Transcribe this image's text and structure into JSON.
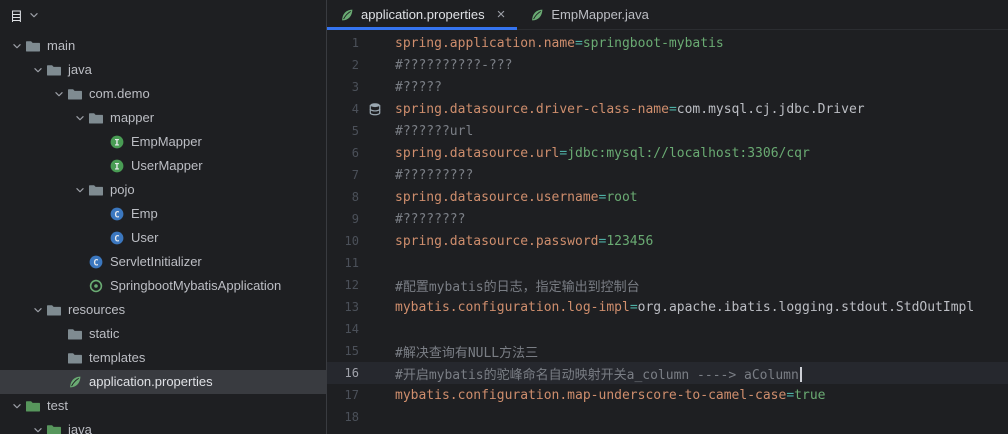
{
  "colors": {
    "app-bg": "#1e1f22",
    "panel-bg": "#1e1f22",
    "editor-bg": "#1e1f22",
    "border": "#393b40",
    "fg": "#bcbec4",
    "fg-bright": "#dfe1e5",
    "key": "#cf8e6d",
    "eq": "#4eb0a5",
    "value": "#6aab73",
    "classref": "#bcbec4",
    "comment": "#7a7e85",
    "line-num": "#4b5059",
    "line-num-current": "#a1a3ab",
    "current-line": "#26282e",
    "selection": "#393b40",
    "tab-underline": "#3574f0",
    "caret": "#ced0d6",
    "chevron": "#9da0a8",
    "leaf-green": "#6aab73",
    "interface-green": "#499c54",
    "class-blue": "#3b77bf",
    "folder-gray": "#7f8b91",
    "folder-green": "#57965c",
    "db-icon": "#9aa7b0"
  },
  "project_panel": {
    "header": {
      "title": "目"
    },
    "tree": [
      {
        "label": "main",
        "icon": "folder-icon",
        "depth": 0,
        "chevron": true,
        "selected": false
      },
      {
        "label": "java",
        "icon": "folder-icon",
        "depth": 1,
        "chevron": true,
        "selected": false
      },
      {
        "label": "com.demo",
        "icon": "package-icon",
        "depth": 2,
        "chevron": true,
        "selected": false
      },
      {
        "label": "mapper",
        "icon": "package-icon",
        "depth": 3,
        "chevron": true,
        "selected": false
      },
      {
        "label": "EmpMapper",
        "icon": "interface-icon",
        "depth": 4,
        "chevron": false,
        "selected": false
      },
      {
        "label": "UserMapper",
        "icon": "interface-icon",
        "depth": 4,
        "chevron": false,
        "selected": false
      },
      {
        "label": "pojo",
        "icon": "package-icon",
        "depth": 3,
        "chevron": true,
        "selected": false
      },
      {
        "label": "Emp",
        "icon": "class-icon",
        "depth": 4,
        "chevron": false,
        "selected": false
      },
      {
        "label": "User",
        "icon": "class-icon",
        "depth": 4,
        "chevron": false,
        "selected": false
      },
      {
        "label": "ServletInitializer",
        "icon": "class-icon",
        "depth": 3,
        "chevron": false,
        "selected": false
      },
      {
        "label": "SpringbootMybatisApplication",
        "icon": "spring-boot-icon",
        "depth": 3,
        "chevron": false,
        "selected": false
      },
      {
        "label": "resources",
        "icon": "folder-icon",
        "depth": 1,
        "chevron": true,
        "selected": false
      },
      {
        "label": "static",
        "icon": "folder-icon",
        "depth": 2,
        "chevron": false,
        "selected": false
      },
      {
        "label": "templates",
        "icon": "folder-icon",
        "depth": 2,
        "chevron": false,
        "selected": false
      },
      {
        "label": "application.properties",
        "icon": "spring-leaf-icon",
        "depth": 2,
        "chevron": false,
        "selected": true
      },
      {
        "label": "test",
        "icon": "test-folder-icon",
        "depth": 0,
        "chevron": true,
        "selected": false
      },
      {
        "label": "java",
        "icon": "test-folder-icon",
        "depth": 1,
        "chevron": true,
        "selected": false
      }
    ]
  },
  "editor": {
    "tabs": [
      {
        "label": "application.properties",
        "icon": "spring-leaf-icon",
        "active": true,
        "closable": true,
        "close_glyph": "×"
      },
      {
        "label": "EmpMapper.java",
        "icon": "spring-leaf-icon",
        "active": false,
        "closable": false
      }
    ],
    "lines": [
      {
        "num": 1,
        "segments": [
          {
            "type": "key",
            "text": "spring.application.name"
          },
          {
            "type": "eq",
            "text": "="
          },
          {
            "type": "value",
            "text": "springboot-mybatis"
          }
        ]
      },
      {
        "num": 2,
        "segments": [
          {
            "type": "comment",
            "text": "#??????????-???"
          }
        ]
      },
      {
        "num": 3,
        "segments": [
          {
            "type": "comment",
            "text": "#?????"
          }
        ]
      },
      {
        "num": 4,
        "gutter_icon": "database-icon",
        "segments": [
          {
            "type": "key",
            "text": "spring.datasource.driver-class-name"
          },
          {
            "type": "eq",
            "text": "="
          },
          {
            "type": "classref",
            "text": "com.mysql.cj.jdbc.Driver"
          }
        ]
      },
      {
        "num": 5,
        "segments": [
          {
            "type": "comment",
            "text": "#??????url"
          }
        ]
      },
      {
        "num": 6,
        "segments": [
          {
            "type": "key",
            "text": "spring.datasource.url"
          },
          {
            "type": "eq",
            "text": "="
          },
          {
            "type": "value",
            "text": "jdbc:mysql://localhost:3306/cqr"
          }
        ]
      },
      {
        "num": 7,
        "segments": [
          {
            "type": "comment",
            "text": "#?????????"
          }
        ]
      },
      {
        "num": 8,
        "segments": [
          {
            "type": "key",
            "text": "spring.datasource.username"
          },
          {
            "type": "eq",
            "text": "="
          },
          {
            "type": "value",
            "text": "root"
          }
        ]
      },
      {
        "num": 9,
        "segments": [
          {
            "type": "comment",
            "text": "#????????"
          }
        ]
      },
      {
        "num": 10,
        "segments": [
          {
            "type": "key",
            "text": "spring.datasource.password"
          },
          {
            "type": "eq",
            "text": "="
          },
          {
            "type": "value",
            "text": "123456"
          }
        ]
      },
      {
        "num": 11,
        "segments": []
      },
      {
        "num": 12,
        "segments": [
          {
            "type": "comment",
            "text": "#配置mybatis的日志，指定输出到控制台"
          }
        ]
      },
      {
        "num": 13,
        "segments": [
          {
            "type": "key",
            "text": "mybatis.configuration.log-impl"
          },
          {
            "type": "eq",
            "text": "="
          },
          {
            "type": "classref",
            "text": "org.apache.ibatis.logging.stdout.StdOutImpl"
          }
        ]
      },
      {
        "num": 14,
        "segments": []
      },
      {
        "num": 15,
        "segments": [
          {
            "type": "comment",
            "text": "#解决查询有NULL方法三"
          }
        ]
      },
      {
        "num": 16,
        "current": true,
        "caret": true,
        "segments": [
          {
            "type": "comment",
            "text": "#开启mybatis的驼峰命名自动映射开关a_column ----> aColumn"
          }
        ]
      },
      {
        "num": 17,
        "segments": [
          {
            "type": "key",
            "text": "mybatis.configuration.map-underscore-to-camel-case"
          },
          {
            "type": "eq",
            "text": "="
          },
          {
            "type": "value",
            "text": "true"
          }
        ]
      },
      {
        "num": 18,
        "segments": []
      }
    ]
  }
}
